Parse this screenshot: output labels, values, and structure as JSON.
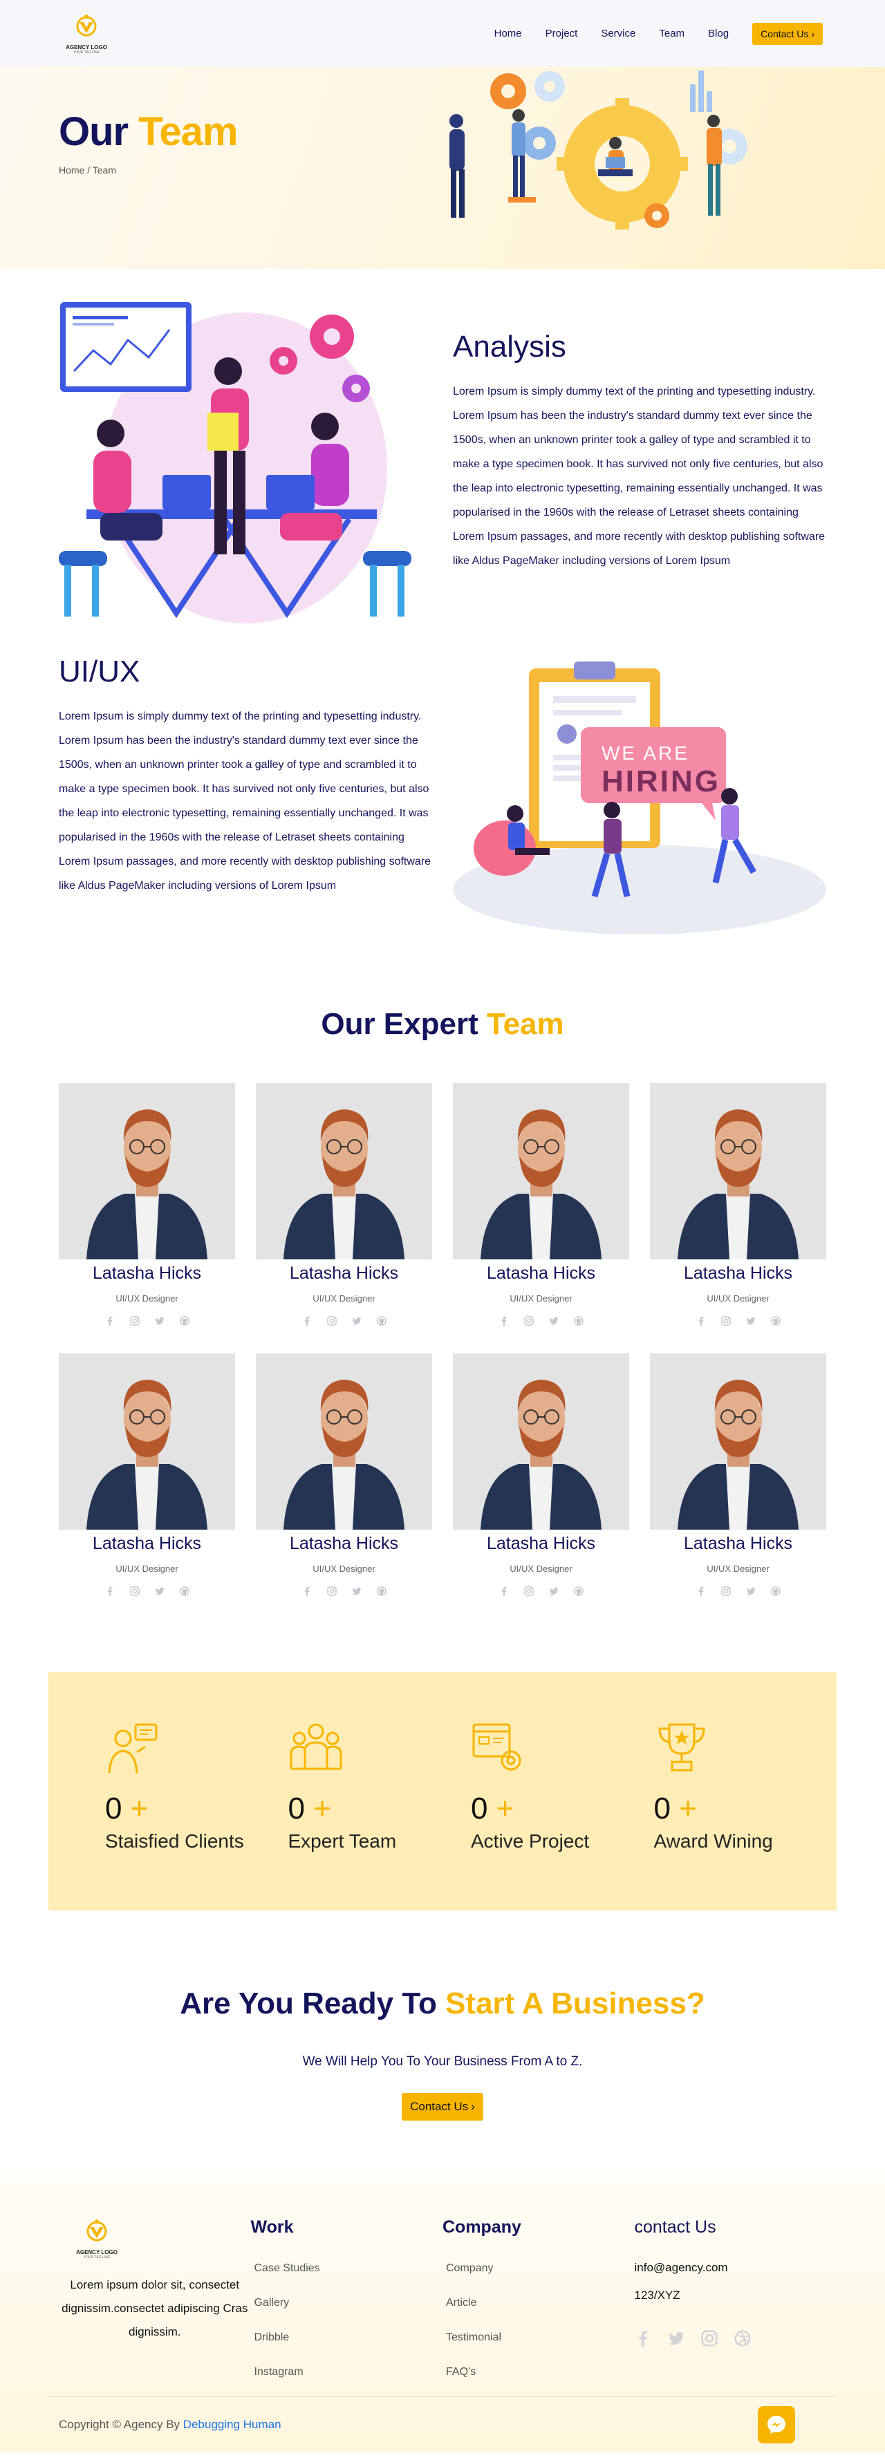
{
  "nav": {
    "logo_text": "AGENCY LOGO",
    "logo_sub": "YOUR TAG LINE",
    "links": [
      "Home",
      "Project",
      "Service",
      "Team",
      "Blog"
    ],
    "contact_label": "Contact Us",
    "contact_icon": "chevron-right-icon"
  },
  "hero": {
    "title_part1": "Our",
    "title_part2": "Team",
    "breadcrumb": "Home / Team"
  },
  "analysis": {
    "title": "Analysis",
    "text": "Lorem Ipsum is simply dummy text of the printing and typesetting industry. Lorem Ipsum has been the industry's standard dummy text ever since the 1500s, when an unknown printer took a galley of type and scrambled it to make a type specimen book. It has survived not only five centuries, but also the leap into electronic typesetting, remaining essentially unchanged. It was popularised in the 1960s with the release of Letraset sheets containing Lorem Ipsum passages, and more recently with desktop publishing software like Aldus PageMaker including versions of Lorem Ipsum"
  },
  "uiux": {
    "title": "UI/UX",
    "text": "Lorem Ipsum is simply dummy text of the printing and typesetting industry. Lorem Ipsum has been the industry's standard dummy text ever since the 1500s, when an unknown printer took a galley of type and scrambled it to make a type specimen book. It has survived not only five centuries, but also the leap into electronic typesetting, remaining essentially unchanged. It was popularised in the 1960s with the release of Letraset sheets containing Lorem Ipsum passages, and more recently with desktop publishing software like Aldus PageMaker including versions of Lorem Ipsum",
    "banner_line1": "WE ARE",
    "banner_line2": "HIRING"
  },
  "team": {
    "title_part1": "Our Expert",
    "title_part2": "Team",
    "members": [
      {
        "name": "Latasha Hicks",
        "role": "UI/UX Designer"
      },
      {
        "name": "Latasha Hicks",
        "role": "UI/UX Designer"
      },
      {
        "name": "Latasha Hicks",
        "role": "UI/UX Designer"
      },
      {
        "name": "Latasha Hicks",
        "role": "UI/UX Designer"
      },
      {
        "name": "Latasha Hicks",
        "role": "UI/UX Designer"
      },
      {
        "name": "Latasha Hicks",
        "role": "UI/UX Designer"
      },
      {
        "name": "Latasha Hicks",
        "role": "UI/UX Designer"
      },
      {
        "name": "Latasha Hicks",
        "role": "UI/UX Designer"
      }
    ],
    "social_icons": [
      "facebook-icon",
      "instagram-icon",
      "twitter-icon",
      "github-icon"
    ]
  },
  "stats": [
    {
      "icon": "client-icon",
      "value": "0",
      "plus": "+",
      "label": "Staisfied Clients"
    },
    {
      "icon": "team-icon",
      "value": "0",
      "plus": "+",
      "label": "Expert Team"
    },
    {
      "icon": "project-icon",
      "value": "0",
      "plus": "+",
      "label": "Active Project"
    },
    {
      "icon": "trophy-icon",
      "value": "0",
      "plus": "+",
      "label": "Award Wining"
    }
  ],
  "cta": {
    "title_part1": "Are You Ready To",
    "title_part2": "Start A Business?",
    "subtitle": "We Will Help You To Your Business From A to Z.",
    "button": "Contact Us"
  },
  "footer": {
    "about": "Lorem ipsum dolor sit, consectet dignissim.consectet adipiscing Cras dignissim.",
    "work_title": "Work",
    "work_links": [
      "Case Studies",
      "Gallery",
      "Dribble",
      "Instagram"
    ],
    "company_title": "Company",
    "company_links": [
      "Company",
      "Article",
      "Testimonial",
      "FAQ's"
    ],
    "contact_title": "contact Us",
    "email": "info@agency.com",
    "phone": "123/XYZ",
    "copyright_prefix": "Copyright © Agency By",
    "copyright_link": "Debugging Human"
  },
  "colors": {
    "navy": "#14145c",
    "gold": "#f7b500",
    "stats_bg": "#ffedb5"
  }
}
